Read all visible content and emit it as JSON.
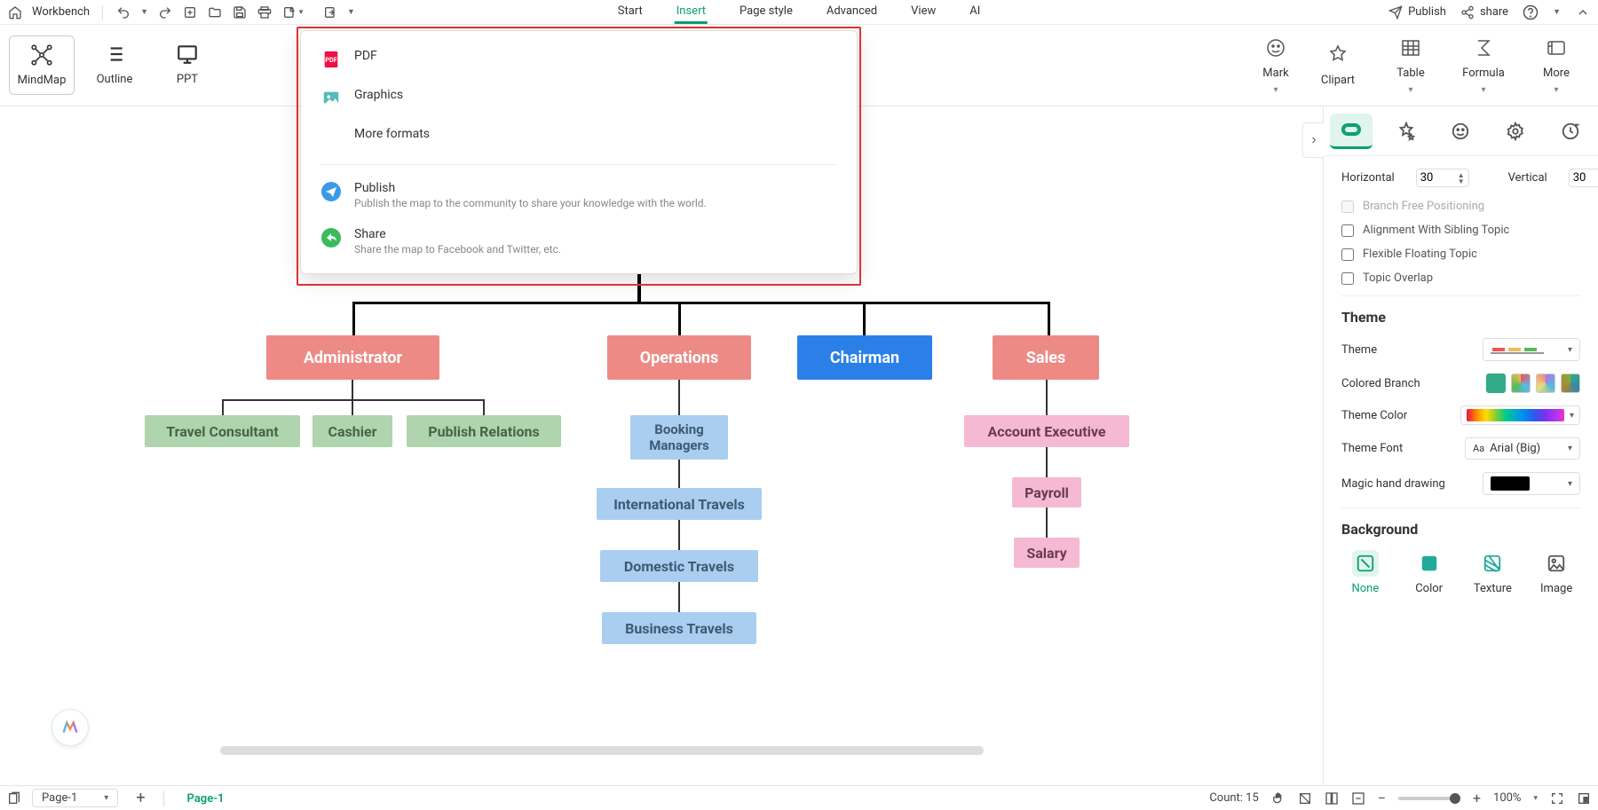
{
  "topbar": {
    "workbench": "Workbench",
    "menu": {
      "start": "Start",
      "insert": "Insert",
      "page_style": "Page style",
      "advanced": "Advanced",
      "view": "View",
      "ai": "AI"
    },
    "publish": "Publish",
    "share": "share"
  },
  "ribbon": {
    "mindmap": "MindMap",
    "outline": "Outline",
    "ppt": "PPT",
    "mark": "Mark",
    "clipart": "Clipart",
    "table": "Table",
    "formula": "Formula",
    "more": "More"
  },
  "dropdown": {
    "pdf": "PDF",
    "graphics": "Graphics",
    "more_formats": "More formats",
    "publish_title": "Publish",
    "publish_sub": "Publish the map to the community to share your knowledge with the world.",
    "share_title": "Share",
    "share_sub": "Share the map to Facebook and Twitter, etc."
  },
  "nodes": {
    "administrator": "Administrator",
    "operations": "Operations",
    "chairman": "Chairman",
    "sales": "Sales",
    "travel_consultant": "Travel Consultant",
    "cashier": "Cashier",
    "publish_relations": "Publish Relations",
    "booking_managers": "Booking Managers",
    "international": "International Travels",
    "domestic": "Domestic Travels",
    "business": "Business Travels",
    "account_exec": "Account Executive",
    "payroll": "Payroll",
    "salary": "Salary"
  },
  "rightpanel": {
    "horizontal": "Horizontal",
    "hv": "30",
    "vertical": "Vertical",
    "vv": "30",
    "branch_free": "Branch Free Positioning",
    "align_sibling": "Alignment With Sibling Topic",
    "flex_float": "Flexible Floating Topic",
    "topic_overlap": "Topic Overlap",
    "theme_section": "Theme",
    "theme": "Theme",
    "colored_branch": "Colored Branch",
    "theme_color": "Theme Color",
    "theme_font": "Theme Font",
    "theme_font_val": "Arial (Big)",
    "magic": "Magic hand drawing",
    "background_section": "Background",
    "bg_none": "None",
    "bg_color": "Color",
    "bg_texture": "Texture",
    "bg_image": "Image"
  },
  "status": {
    "page_sel": "Page-1",
    "page_tab": "Page-1",
    "count": "Count: 15",
    "zoom": "100%"
  }
}
